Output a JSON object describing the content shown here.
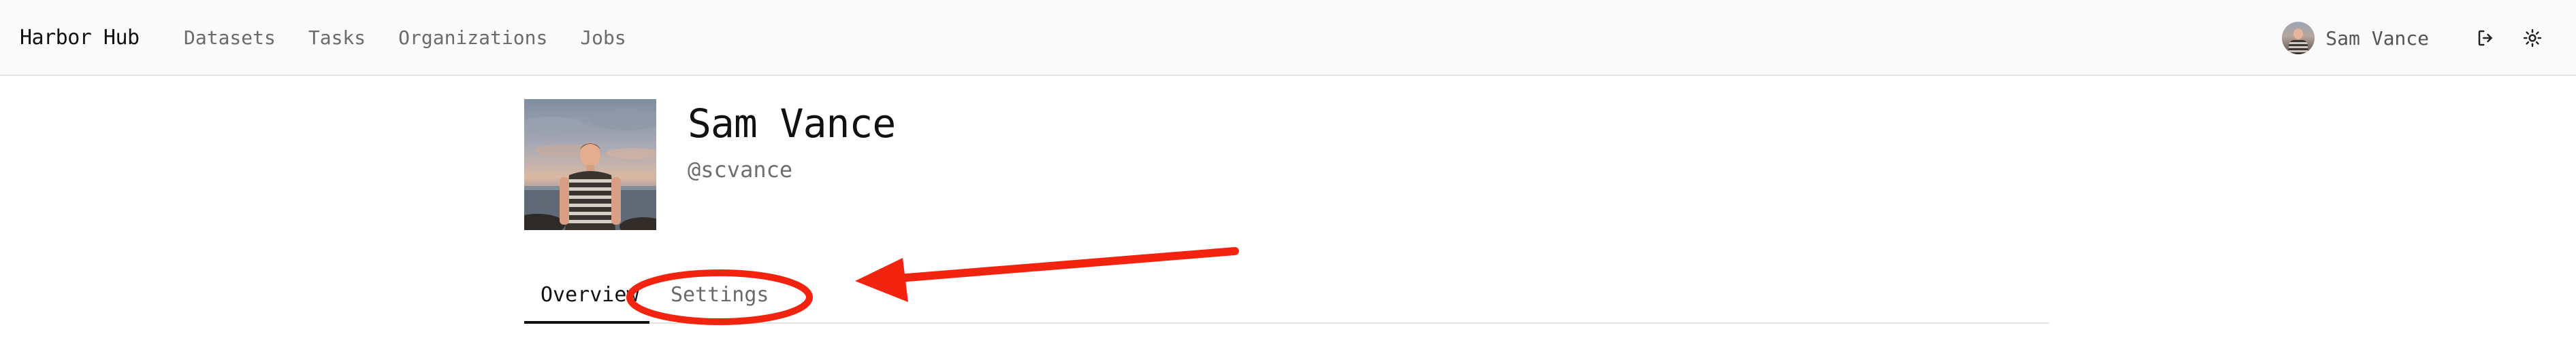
{
  "app": {
    "brand": "Harbor Hub"
  },
  "nav": {
    "links": [
      "Datasets",
      "Tasks",
      "Organizations",
      "Jobs"
    ]
  },
  "user_menu": {
    "name": "Sam Vance",
    "icons": [
      "avatar",
      "logout-icon",
      "theme-toggle-sun-icon"
    ]
  },
  "profile": {
    "name": "Sam Vance",
    "handle": "@scvance"
  },
  "tabs": {
    "items": [
      "Overview",
      "Settings"
    ],
    "active": "Overview"
  },
  "annotation": {
    "shapes": [
      "red-ellipse-around-settings-tab",
      "red-arrow-pointing-to-settings-tab"
    ],
    "color": "#f2240f"
  },
  "colors": {
    "topbar_bg": "#fafafa",
    "text_primary": "#111111",
    "text_muted": "#6b6b6b"
  }
}
